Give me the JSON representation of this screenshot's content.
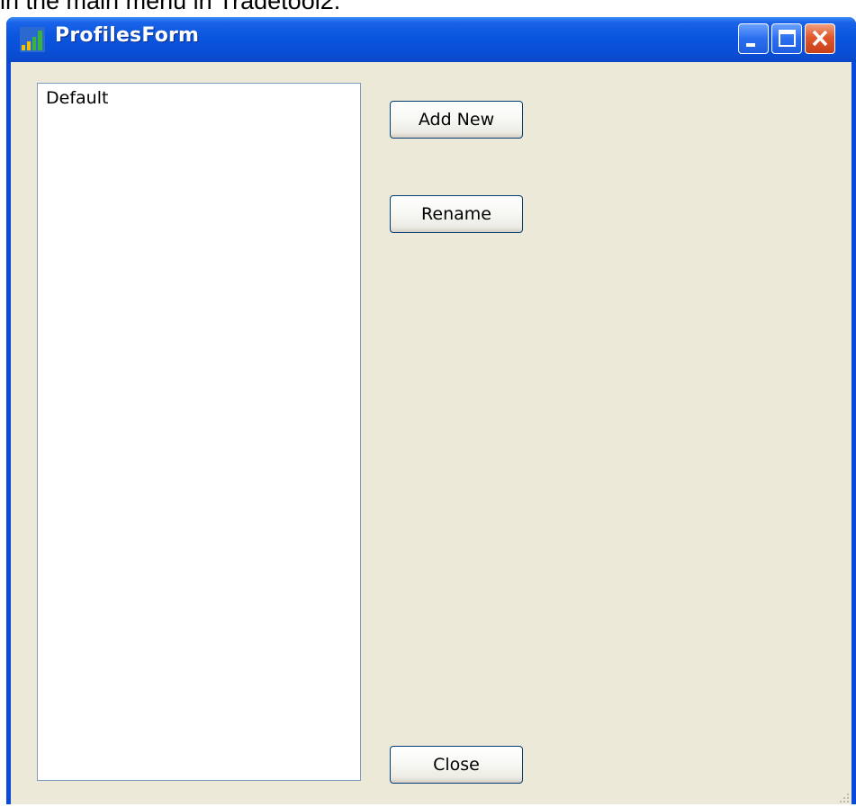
{
  "page": {
    "top_caption": "in the main menu in Tradetool2."
  },
  "window": {
    "title": "ProfilesForm",
    "app_icon": "bar-chart-icon",
    "controls": {
      "minimize_icon": "minimize-icon",
      "maximize_icon": "maximize-icon",
      "close_icon": "close-icon"
    }
  },
  "profiles_list": {
    "items": [
      "Default"
    ]
  },
  "buttons": {
    "add_new": "Add New",
    "rename": "Rename",
    "close": "Close"
  },
  "colors": {
    "titlebar": "#0a55df",
    "client_background": "#ece9d8",
    "close_button": "#e0582a",
    "button_border": "#003c74"
  }
}
